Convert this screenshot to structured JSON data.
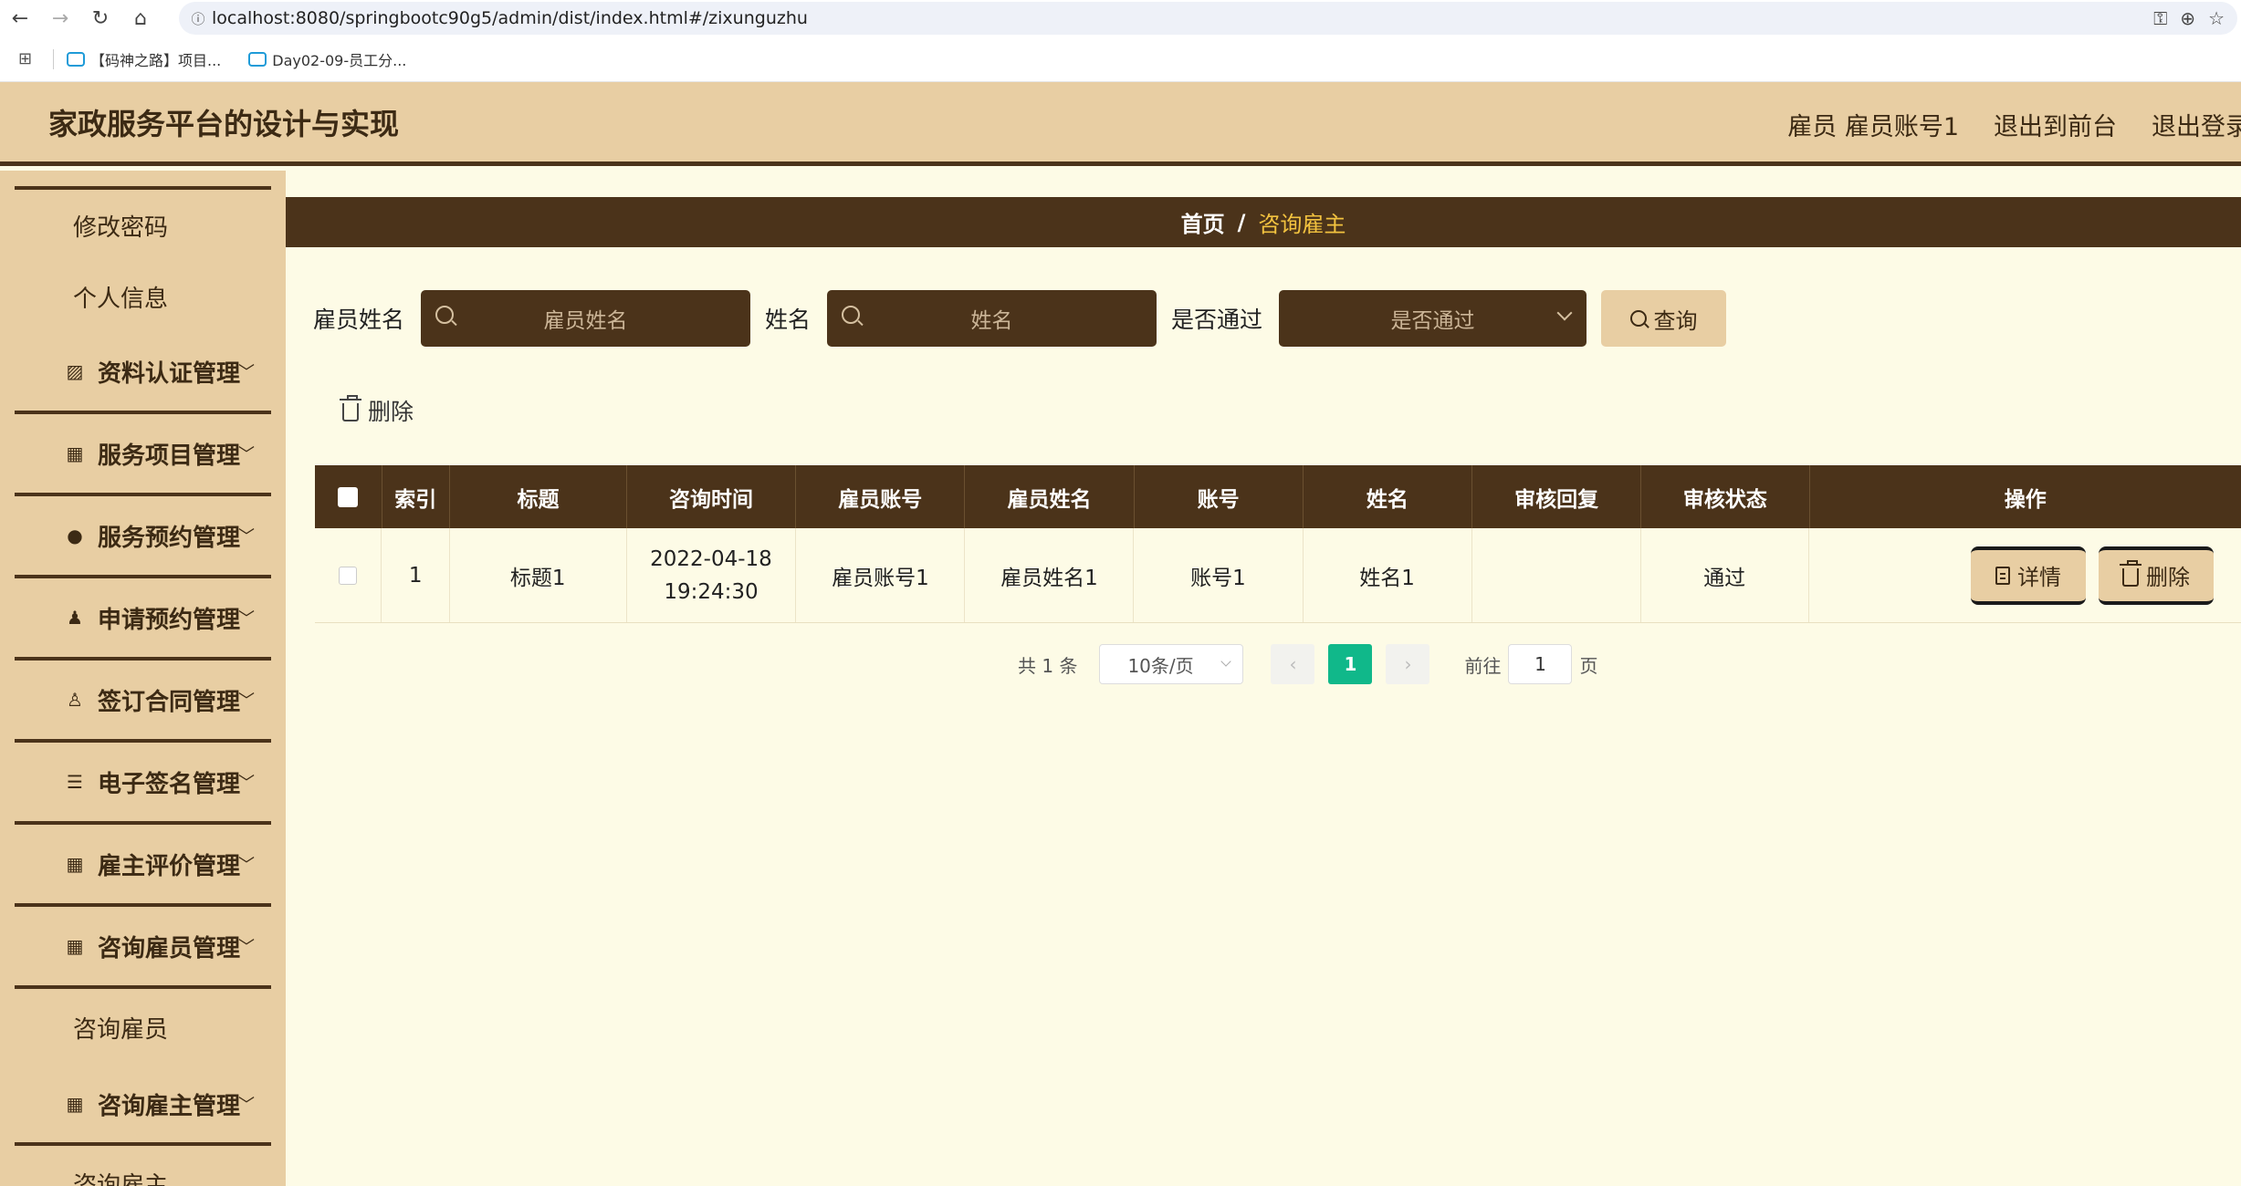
{
  "browser": {
    "url": "localhost:8080/springbootc90g5/admin/dist/index.html#/zixunguzhu",
    "bookmarks": [
      "【码神之路】项目...",
      "Day02-09-员工分..."
    ]
  },
  "header": {
    "title": "家政服务平台的设计与实现",
    "user": "雇员 雇员账号1",
    "front": "退出到前台",
    "logout": "退出登录"
  },
  "sidebar": {
    "top_items": [
      "修改密码",
      "个人信息"
    ],
    "menus": [
      {
        "label": "资料认证管理",
        "icon": "chart-icon"
      },
      {
        "label": "服务项目管理",
        "icon": "grid-icon"
      },
      {
        "label": "服务预约管理",
        "icon": "bulb-icon"
      },
      {
        "label": "申请预约管理",
        "icon": "person-icon"
      },
      {
        "label": "签订合同管理",
        "icon": "user-icon"
      },
      {
        "label": "电子签名管理",
        "icon": "sliders-icon"
      },
      {
        "label": "雇主评价管理",
        "icon": "grid-icon"
      },
      {
        "label": "咨询雇员管理",
        "icon": "grid-icon"
      }
    ],
    "sub_item": "咨询雇员",
    "menu_last": "咨询雇主管理",
    "sub_item_last": "咨询雇主"
  },
  "breadcrumb": {
    "home": "首页",
    "sep": "/",
    "current": "咨询雇主"
  },
  "search": {
    "label1": "雇员姓名",
    "placeholder1": "雇员姓名",
    "label2": "姓名",
    "placeholder2": "姓名",
    "label3": "是否通过",
    "select_placeholder": "是否通过",
    "query": "查询"
  },
  "actions": {
    "delete": "删除"
  },
  "table": {
    "headers": [
      "索引",
      "标题",
      "咨询时间",
      "雇员账号",
      "雇员姓名",
      "账号",
      "姓名",
      "审核回复",
      "审核状态",
      "操作"
    ],
    "rows": [
      {
        "index": "1",
        "title": "标题1",
        "time": "2022-04-18 19:24:30",
        "emp_account": "雇员账号1",
        "emp_name": "雇员姓名1",
        "account": "账号1",
        "name": "姓名1",
        "reply": "",
        "status": "通过"
      }
    ],
    "detail": "详情",
    "delete": "删除"
  },
  "pager": {
    "total": "共 1 条",
    "size": "10条/页",
    "page": "1",
    "goto": "前往",
    "goto_value": "1",
    "page_unit": "页"
  },
  "colors": {
    "header_bg": "#e8cea3",
    "dark": "#4b331a",
    "accent": "#f2c23f",
    "page_bg": "#fdfbe6",
    "active_page": "#10b88a"
  }
}
